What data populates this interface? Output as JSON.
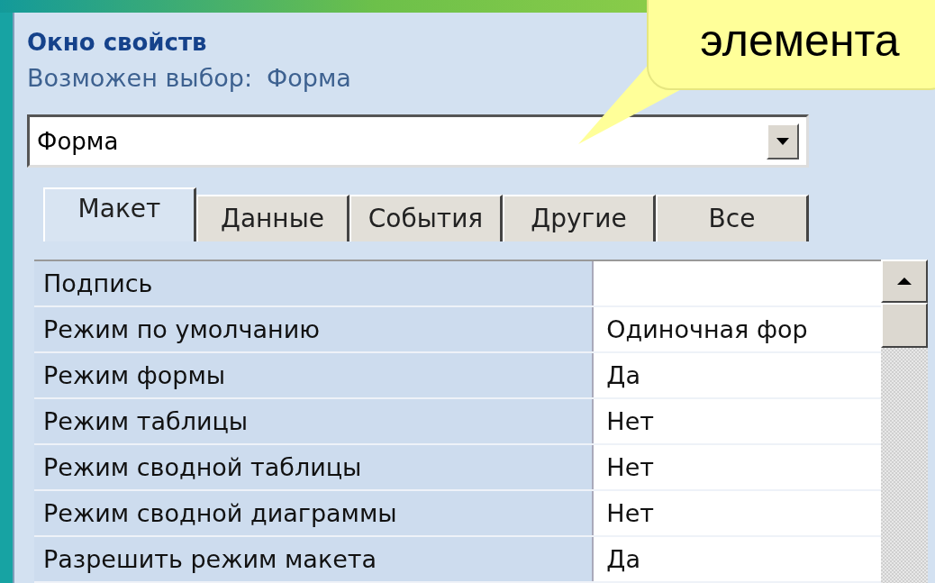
{
  "panel": {
    "title": "Окно свойств",
    "selection_label": "Возможен выбор:",
    "selection_value": "Форма"
  },
  "object_combo": {
    "value": "Форма"
  },
  "tabs": [
    {
      "label": "Макет",
      "selected": true
    },
    {
      "label": "Данные",
      "selected": false
    },
    {
      "label": "События",
      "selected": false
    },
    {
      "label": "Другие",
      "selected": false
    },
    {
      "label": "Все",
      "selected": false
    }
  ],
  "properties": [
    {
      "name": "Подпись"
    },
    {
      "name": "Режим по умолчанию",
      "value": "Одиночная фор"
    },
    {
      "name": "Режим формы",
      "value": "Да"
    },
    {
      "name": "Режим таблицы",
      "value": "Нет"
    },
    {
      "name": "Режим сводной таблицы",
      "value": "Нет"
    },
    {
      "name": "Режим сводной диаграммы",
      "value": "Нет"
    },
    {
      "name": "Разрешить режим макета",
      "value": "Да"
    }
  ],
  "callout": {
    "text": "элемента"
  }
}
